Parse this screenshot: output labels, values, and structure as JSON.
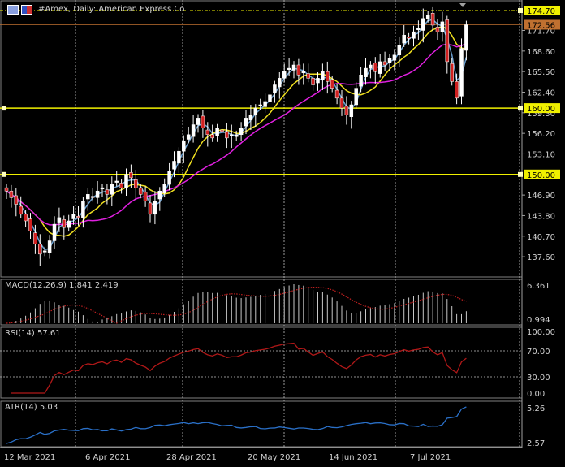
{
  "header": {
    "title": "#Amex, Daily:  American Express Co",
    "icons": [
      "chart-window-icon",
      "flag-icon"
    ]
  },
  "colors": {
    "background": "#000000",
    "candle_up": "#ffffff",
    "candle_down": "#d02020",
    "sma_fast": "#6a9fd0",
    "sma_mid": "#f0e020",
    "sma_slow": "#e020e0",
    "level": "#f0f000",
    "bid": "#c07030",
    "macd_hist": "#c8c8c8",
    "macd_signal": "#c02020",
    "rsi": "#b01818",
    "atr": "#2a70c8"
  },
  "chart_data": [
    {
      "type": "candlestick",
      "title": "#Amex, Daily:  American Express Co",
      "ylim": [
        135.5,
        176
      ],
      "yticks": [
        "171.70",
        "168.60",
        "165.50",
        "162.40",
        "159.30",
        "156.20",
        "153.10",
        "146.90",
        "143.80",
        "140.70",
        "137.60"
      ],
      "xticks": [
        "12 Mar 2021",
        "6 Apr 2021",
        "28 Apr 2021",
        "20 May 2021",
        "14 Jun 2021",
        "7 Jul 2021"
      ],
      "close": [
        147.5,
        146.5,
        145.5,
        144,
        143,
        141.5,
        139.5,
        138,
        138.5,
        140,
        142.5,
        143.5,
        142,
        143,
        144,
        143.5,
        146,
        147,
        146.5,
        147.5,
        148,
        147,
        148.5,
        149,
        148,
        150,
        149.5,
        148,
        147,
        146,
        144,
        146,
        147.5,
        148.5,
        150.5,
        152,
        153.5,
        155,
        156,
        157.5,
        158.5,
        157,
        156,
        155.5,
        157,
        156.5,
        155.5,
        156,
        156,
        157,
        158.5,
        159,
        160,
        160.5,
        161,
        162,
        163.5,
        164.5,
        165.5,
        166,
        166.5,
        165,
        165.5,
        164.5,
        163.5,
        164.5,
        165.5,
        164,
        163,
        161.5,
        160,
        159,
        160.5,
        163,
        165,
        166,
        166.5,
        165.5,
        167,
        166.5,
        167.5,
        168,
        169.5,
        171,
        170.5,
        171.5,
        172,
        173.5,
        174,
        172.5,
        171.5,
        173,
        167,
        164,
        161.5,
        169,
        172.56
      ],
      "levels": [
        {
          "value": 174.7,
          "label": "174.70",
          "style": "dashed"
        },
        {
          "value": 160.0,
          "label": "160.00",
          "style": "solid"
        },
        {
          "value": 150.0,
          "label": "150.00",
          "style": "solid"
        }
      ],
      "bid": {
        "value": 172.56,
        "label": "172.56"
      }
    },
    {
      "type": "bar",
      "name": "MACD(12,26,9) 1.841 2.419",
      "yticks": [
        "6.361",
        "0.994"
      ]
    },
    {
      "type": "line",
      "name": "RSI(14) 57.61",
      "ylim": [
        0,
        100
      ],
      "yticks": [
        "100.00",
        "70.00",
        "30.00",
        "0.00"
      ]
    },
    {
      "type": "line",
      "name": "ATR(14) 5.03",
      "yticks": [
        "5.26",
        "2.57"
      ]
    }
  ]
}
